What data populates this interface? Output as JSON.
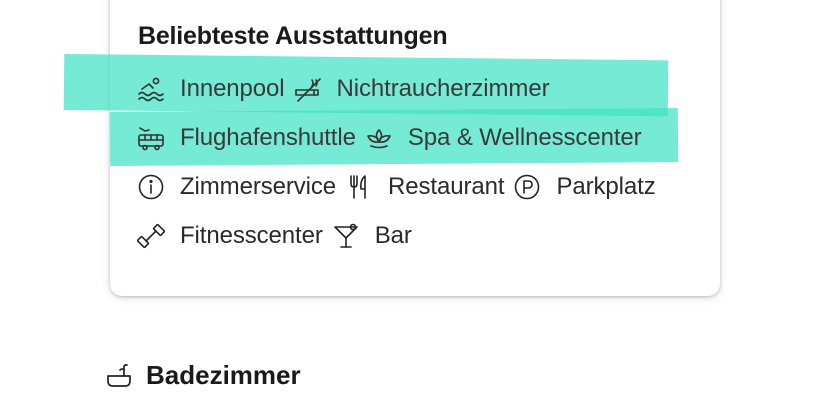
{
  "amenities_card": {
    "title": "Beliebteste Ausstattungen",
    "rows": [
      [
        {
          "label": "Innenpool",
          "icon": "swimming-icon"
        },
        {
          "label": "Nichtraucherzimmer",
          "icon": "no-smoking-icon"
        }
      ],
      [
        {
          "label": "Flughafenshuttle",
          "icon": "airport-shuttle-icon"
        },
        {
          "label": "Spa & Wellnesscenter",
          "icon": "spa-icon"
        }
      ],
      [
        {
          "label": "Zimmerservice",
          "icon": "info-icon"
        },
        {
          "label": "Restaurant",
          "icon": "restaurant-icon"
        },
        {
          "label": "Parkplatz",
          "icon": "parking-icon"
        }
      ],
      [
        {
          "label": "Fitnesscenter",
          "icon": "fitness-icon"
        },
        {
          "label": "Bar",
          "icon": "bar-icon"
        }
      ]
    ]
  },
  "bathroom_section": {
    "title": "Badezimmer",
    "icon": "bathtub-icon"
  },
  "colors": {
    "highlight": "#40e2c4",
    "text": "#1a1a1a"
  }
}
